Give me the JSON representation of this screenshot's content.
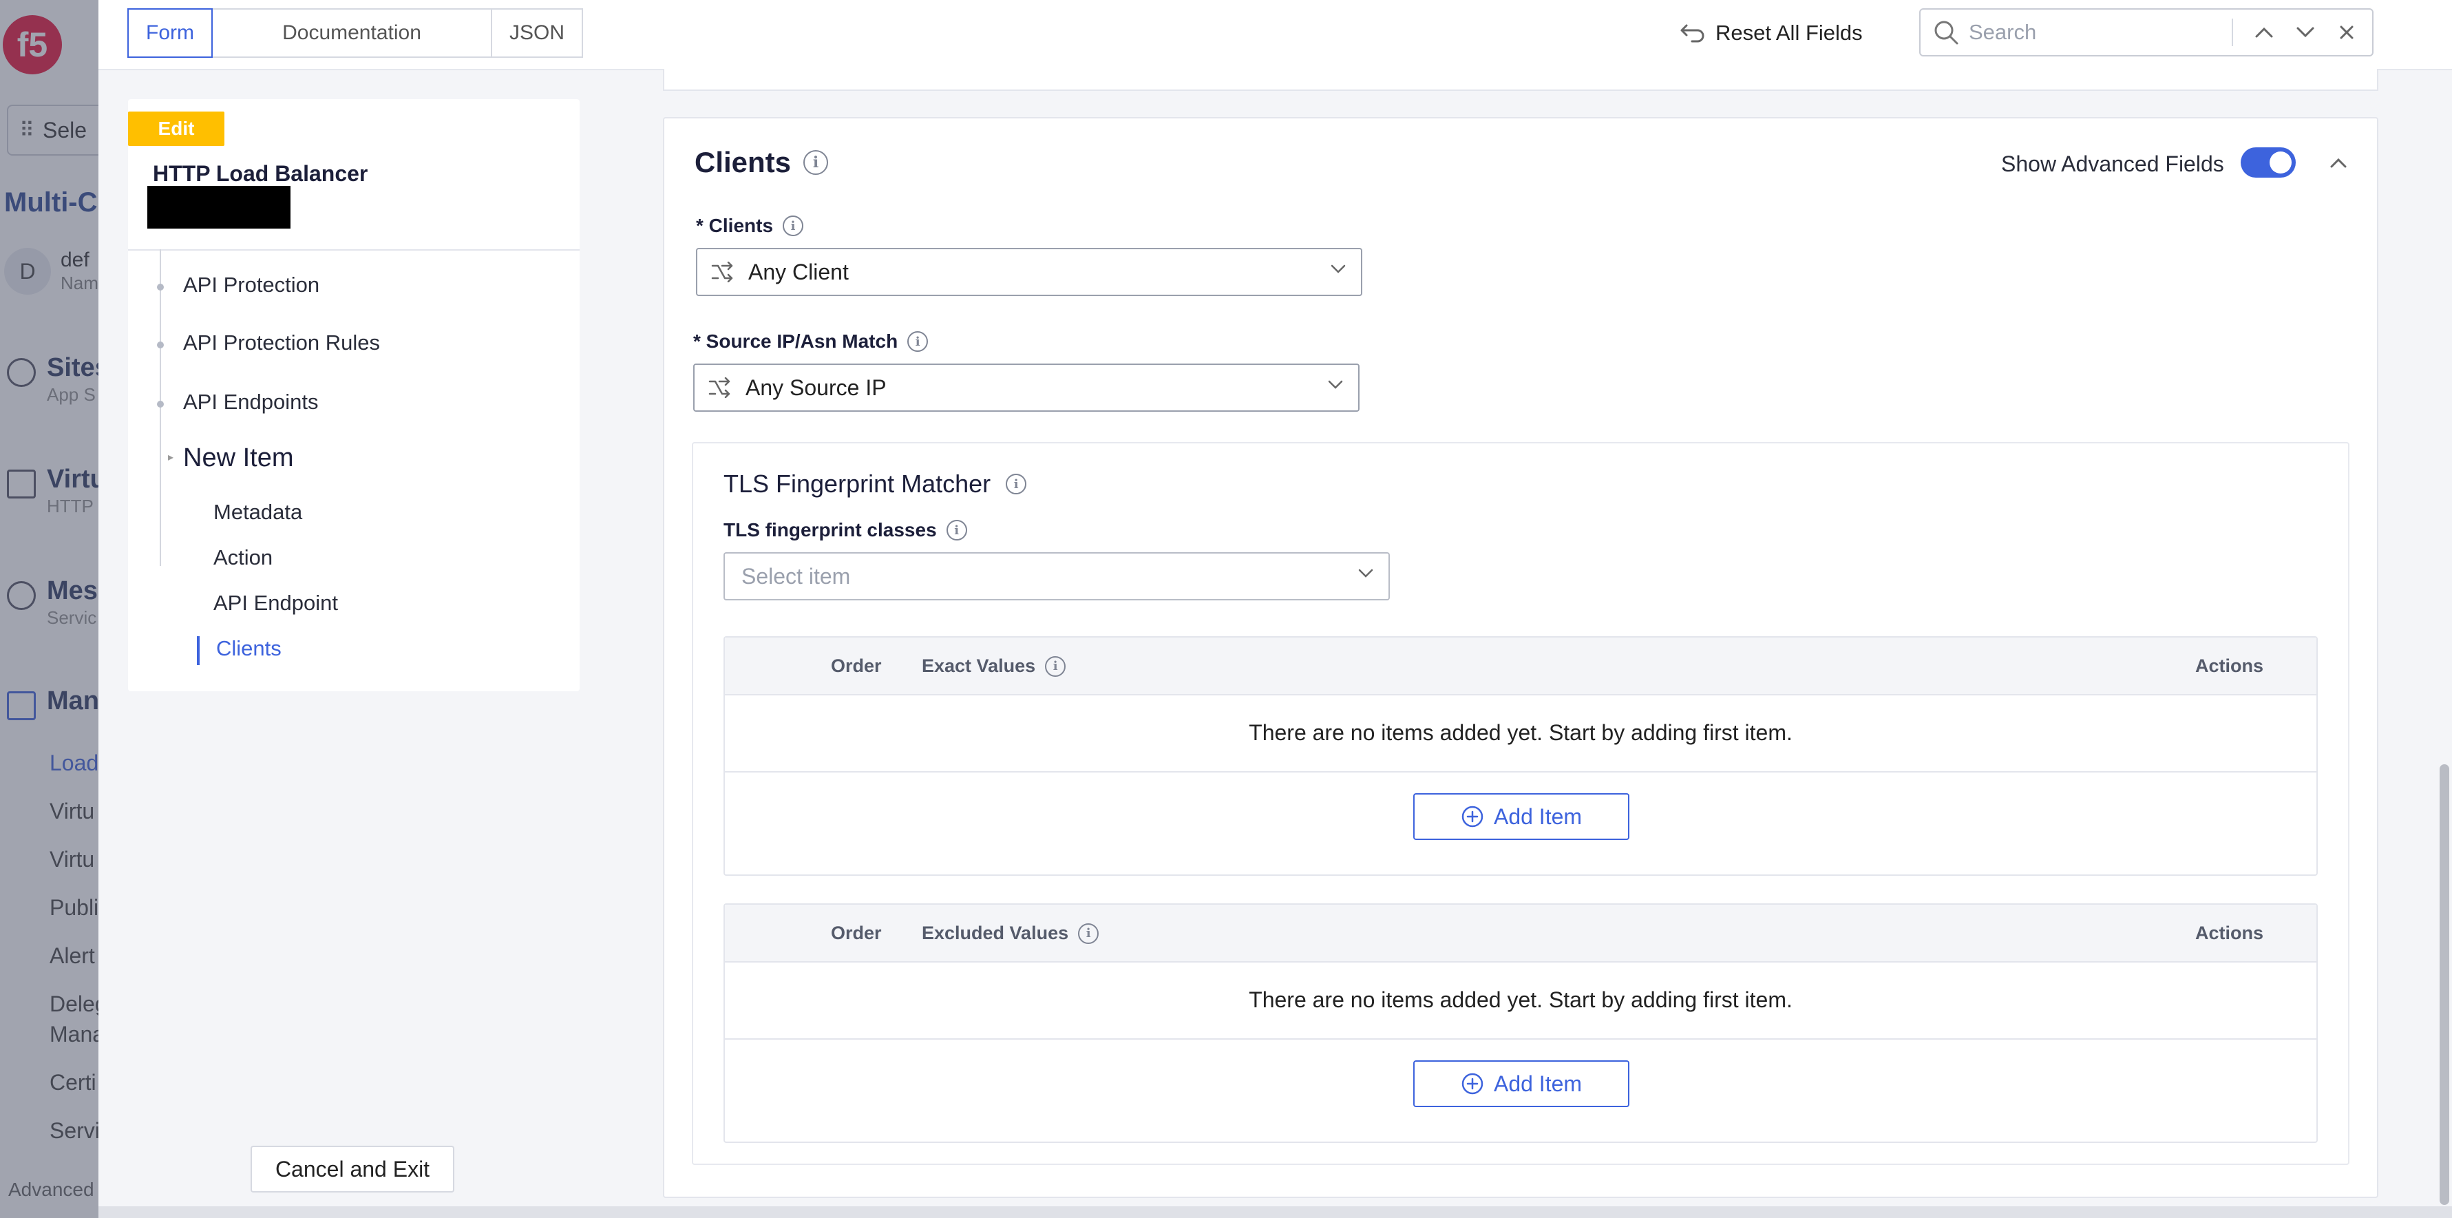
{
  "app_sidebar": {
    "logo_text": "f5",
    "select_label": "Sele",
    "title": "Multi-C",
    "namespace": {
      "avatar": "D",
      "name": "def",
      "sub": "Nam"
    },
    "sections": [
      {
        "label": "Sites",
        "sub": "App S",
        "icon": "globe-icon"
      },
      {
        "label": "Virtu",
        "sub": "HTTP",
        "icon": "servers-icon"
      },
      {
        "label": "Mes",
        "sub": "Servic",
        "icon": "mesh-icon"
      },
      {
        "label": "Man",
        "sub": "",
        "icon": "wrench-icon"
      }
    ],
    "sub_items": [
      "Load",
      "Virtu",
      "Virtu",
      "Publi",
      "Alert",
      "Deleg",
      "Mana",
      "Certi",
      "Servi"
    ],
    "advanced": "Advanced"
  },
  "topbar": {
    "tabs": [
      {
        "label": "Form",
        "active": true
      },
      {
        "label": "Documentation",
        "active": false
      },
      {
        "label": "JSON",
        "active": false
      }
    ],
    "reset_label": "Reset All Fields",
    "search_placeholder": "Search"
  },
  "nav": {
    "badge": "Edit",
    "title": "HTTP Load Balancer",
    "items": [
      "API Protection",
      "API Protection Rules",
      "API Endpoints"
    ],
    "current": "New Item",
    "sub_items": [
      "Metadata",
      "Action",
      "API Endpoint",
      "Clients"
    ],
    "active_sub": "Clients"
  },
  "cancel_label": "Cancel and Exit",
  "clients_card": {
    "title": "Clients",
    "show_advanced_label": "Show Advanced Fields",
    "show_advanced_on": true,
    "clients_field": {
      "label": "* Clients",
      "value": "Any Client"
    },
    "source_field": {
      "label": "* Source IP/Asn Match",
      "value": "Any Source IP"
    },
    "tls": {
      "title": "TLS Fingerprint Matcher",
      "classes_label": "TLS fingerprint classes",
      "classes_placeholder": "Select item",
      "tables": [
        {
          "col_order": "Order",
          "col_values": "Exact Values",
          "col_actions": "Actions",
          "empty_msg": "There are no items added yet. Start by adding first item.",
          "add_label": "Add Item"
        },
        {
          "col_order": "Order",
          "col_values": "Excluded Values",
          "col_actions": "Actions",
          "empty_msg": "There are no items added yet. Start by adding first item.",
          "add_label": "Add Item"
        }
      ]
    }
  },
  "colors": {
    "accent": "#3d63dd",
    "edit_badge": "#ffbf00",
    "brand": "#e4002b"
  }
}
